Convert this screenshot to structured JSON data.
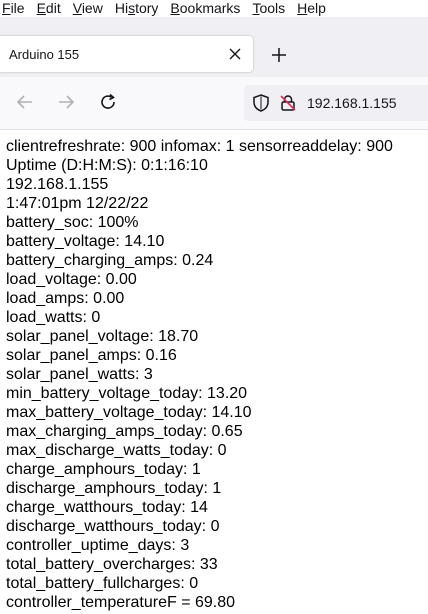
{
  "menubar": {
    "items": [
      {
        "pre": "",
        "u": "F",
        "post": "ile"
      },
      {
        "pre": "",
        "u": "E",
        "post": "dit"
      },
      {
        "pre": "",
        "u": "V",
        "post": "iew"
      },
      {
        "pre": "Hi",
        "u": "s",
        "post": "tory"
      },
      {
        "pre": "",
        "u": "B",
        "post": "ookmarks"
      },
      {
        "pre": "",
        "u": "T",
        "post": "ools"
      },
      {
        "pre": "",
        "u": "H",
        "post": "elp"
      }
    ]
  },
  "tab": {
    "title": "Arduino 155",
    "close_icon": "close-icon"
  },
  "newtab": {
    "icon": "plus-icon"
  },
  "nav": {
    "back_icon": "arrow-left-icon",
    "forward_icon": "arrow-right-icon",
    "reload_icon": "reload-icon",
    "url": "192.168.1.155",
    "shield_icon": "shield-icon",
    "insecure_icon": "insecure-lock-icon"
  },
  "content": {
    "lines": [
      "clientrefreshrate: 900 infomax: 1 sensorreaddelay: 900",
      "Uptime (D:H:M:S): 0:1:16:10",
      "192.168.1.155",
      "1:47:01pm 12/22/22",
      "battery_soc: 100%",
      "battery_voltage: 14.10",
      "battery_charging_amps: 0.24",
      "load_voltage: 0.00",
      "load_amps: 0.00",
      "load_watts: 0",
      "solar_panel_voltage: 18.70",
      "solar_panel_amps: 0.16",
      "solar_panel_watts: 3",
      "min_battery_voltage_today: 13.20",
      "max_battery_voltage_today: 14.10",
      "max_charging_amps_today: 0.65",
      "max_discharge_watts_today: 0",
      "charge_amphours_today: 1",
      "discharge_amphours_today: 1",
      "charge_watthours_today: 14",
      "discharge_watthours_today: 0",
      "controller_uptime_days: 3",
      "total_battery_overcharges: 33",
      "total_battery_fullcharges: 0",
      "controller_temperatureF = 69.80"
    ]
  }
}
